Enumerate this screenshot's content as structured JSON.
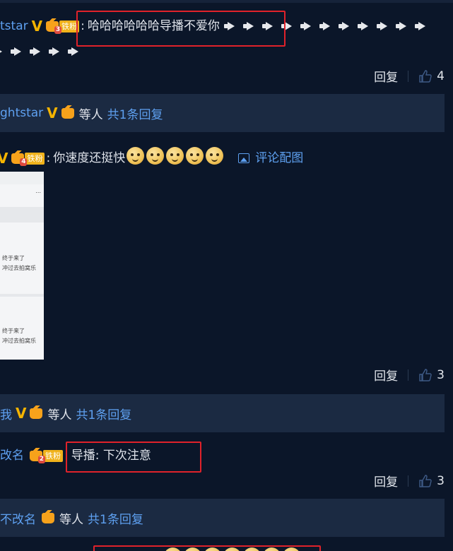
{
  "comment1": {
    "user": "tstar",
    "fan_badge": "铁粉",
    "level": "3",
    "text": "哈哈哈哈哈哈导播不爱你",
    "speakers_line1": 11,
    "speakers_line2": 5,
    "reply_label": "回复",
    "likes": "4"
  },
  "reply_bar1": {
    "user": "ghtstar",
    "others": "等人",
    "count": "共1条回复"
  },
  "comment2": {
    "fan_badge": "铁粉",
    "level": "4",
    "text": "你速度还挺快",
    "image_link": "评论配图",
    "image_text_1": "终于来了",
    "image_text_2": "冲过去拍窝乐",
    "reply_label": "回复",
    "likes": "3"
  },
  "reply_bar2": {
    "user": "我",
    "others": "等人",
    "count": "共1条回复"
  },
  "comment3": {
    "user": "改名",
    "fan_badge": "铁粉",
    "level": "2",
    "text": "导播: 下次注意",
    "reply_label": "回复",
    "likes": "3"
  },
  "reply_bar3": {
    "user": "不改名",
    "others": "等人",
    "count": "共1条回复"
  },
  "icons": [
    "v-verified-icon",
    "crown-level-icon",
    "speaker-icon",
    "thumb-up-icon",
    "image-icon",
    "doge-emoji-icon"
  ],
  "colors": {
    "background": "#0b1629",
    "reply_bar": "#1b2a42",
    "link": "#5ea0f0",
    "highlight": "#e0222a",
    "badge": "#f0b21b"
  }
}
